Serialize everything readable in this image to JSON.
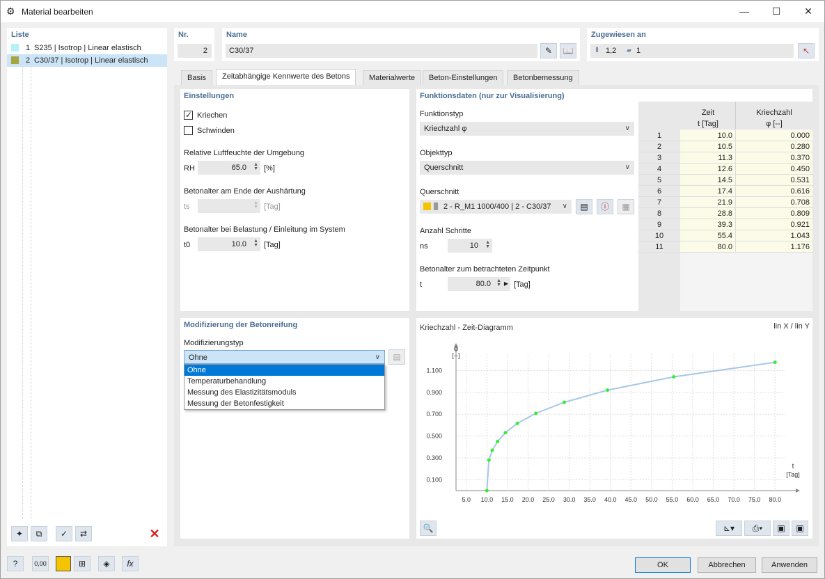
{
  "window": {
    "title": "Material bearbeiten"
  },
  "liste": {
    "header": "Liste",
    "items": [
      {
        "num": "1",
        "label": "S235 | Isotrop | Linear elastisch",
        "color": "#b8f0f8"
      },
      {
        "num": "2",
        "label": "C30/37 | Isotrop | Linear elastisch",
        "color": "#a6a640"
      }
    ]
  },
  "nr": {
    "header": "Nr.",
    "value": "2"
  },
  "name": {
    "header": "Name",
    "value": "C30/37"
  },
  "assigned": {
    "header": "Zugewiesen an",
    "members": "1,2",
    "sections": "1"
  },
  "tabs": [
    "Basis",
    "Zeitabhängige Kennwerte des Betons",
    "Materialwerte",
    "Beton-Einstellungen",
    "Betonbemessung"
  ],
  "einstellungen": {
    "header": "Einstellungen",
    "kriechen": "Kriechen",
    "schwinden": "Schwinden",
    "rh_label": "Relative Luftfeuchte der Umgebung",
    "rh_sym": "RH",
    "rh_value": "65.0",
    "rh_unit": "[%]",
    "ts_label": "Betonalter am Ende der Aushärtung",
    "ts_sym": "ts",
    "ts_unit": "[Tag]",
    "t0_label": "Betonalter bei Belastung / Einleitung im System",
    "t0_sym": "t0",
    "t0_value": "10.0",
    "t0_unit": "[Tag]"
  },
  "funktionsdaten": {
    "header": "Funktionsdaten (nur zur Visualisierung)",
    "funktionstyp_label": "Funktionstyp",
    "funktionstyp_value": "Kriechzahl φ",
    "objekttyp_label": "Objekttyp",
    "objekttyp_value": "Querschnitt",
    "querschnitt_label": "Querschnitt",
    "querschnitt_value": "2 - R_M1 1000/400 | 2 - C30/37",
    "schritte_label": "Anzahl Schritte",
    "schritte_sym": "ns",
    "schritte_value": "10",
    "zeitpunkt_label": "Betonalter zum betrachteten Zeitpunkt",
    "zeitpunkt_sym": "t",
    "zeitpunkt_value": "80.0",
    "zeitpunkt_unit": "[Tag]"
  },
  "table": {
    "col1": "Zeit",
    "col1_unit": "t [Tag]",
    "col2": "Kriechzahl",
    "col2_unit": "φ [--]",
    "rows": [
      [
        "1",
        "10.0",
        "0.000"
      ],
      [
        "2",
        "10.5",
        "0.280"
      ],
      [
        "3",
        "11.3",
        "0.370"
      ],
      [
        "4",
        "12.6",
        "0.450"
      ],
      [
        "5",
        "14.5",
        "0.531"
      ],
      [
        "6",
        "17.4",
        "0.616"
      ],
      [
        "7",
        "21.9",
        "0.708"
      ],
      [
        "8",
        "28.8",
        "0.809"
      ],
      [
        "9",
        "39.3",
        "0.921"
      ],
      [
        "10",
        "55.4",
        "1.043"
      ],
      [
        "11",
        "80.0",
        "1.176"
      ]
    ]
  },
  "modifizierung": {
    "header": "Modifizierung der Betonreifung",
    "typ_label": "Modifizierungstyp",
    "typ_value": "Ohne",
    "options": [
      "Ohne",
      "Temperaturbehandlung",
      "Messung des Elastizitätsmoduls",
      "Messung der Betonfestigkeit"
    ]
  },
  "diagram": {
    "title": "Kriechzahl - Zeit-Diagramm",
    "scale": "lin X / lin Y",
    "ylabel": "φ",
    "yunit": "[--]",
    "xlabel": "t",
    "xunit": "[Tag]",
    "yticks": [
      "1.100",
      "0.900",
      "0.700",
      "0.500",
      "0.300",
      "0.100"
    ],
    "xticks": [
      "5.0",
      "10.0",
      "15.0",
      "20.0",
      "25.0",
      "30.0",
      "35.0",
      "40.0",
      "45.0",
      "50.0",
      "55.0",
      "60.0",
      "65.0",
      "70.0",
      "75.0",
      "80.0"
    ]
  },
  "chart_data": {
    "type": "line",
    "title": "Kriechzahl - Zeit-Diagramm",
    "xlabel": "t [Tag]",
    "ylabel": "φ [--]",
    "x": [
      10.0,
      10.5,
      11.3,
      12.6,
      14.5,
      17.4,
      21.9,
      28.8,
      39.3,
      55.4,
      80.0
    ],
    "series": [
      {
        "values": [
          0.0,
          0.28,
          0.37,
          0.45,
          0.531,
          0.616,
          0.708,
          0.809,
          0.921,
          1.043,
          1.176
        ]
      }
    ],
    "xlim": [
      0,
      82
    ],
    "ylim": [
      0,
      1.25
    ],
    "grid": true
  },
  "buttons": {
    "ok": "OK",
    "cancel": "Abbrechen",
    "apply": "Anwenden"
  },
  "colors": {
    "accent": "#0078d7",
    "header_text": "#4a6d94",
    "curve": "#a8c8e8",
    "points": "#33ee33"
  }
}
